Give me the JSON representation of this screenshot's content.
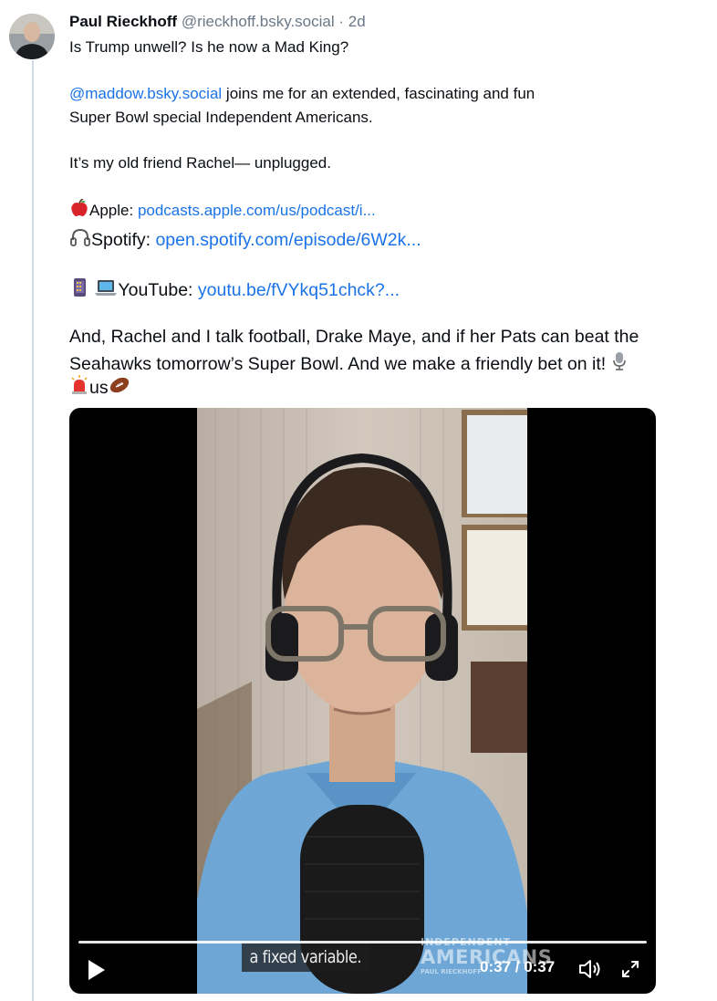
{
  "post": {
    "author_name": "Paul Rieckhoff",
    "author_handle": "@rieckhoff.bsky.social",
    "separator": " · ",
    "time": "2d",
    "line1": "Is Trump unwell? Is he now a Mad King?",
    "mention": "@maddow.bsky.social",
    "line2_rest": "  joins me for an extended, fascinating and fun",
    "line3": "Super Bowl special Independent Americans.",
    "line4": "It’s my old friend Rachel— unplugged.",
    "apple_label": "Apple: ",
    "apple_link": "podcasts.apple.com/us/podcast/i...",
    "spotify_label": "Spotify: ",
    "spotify_link": "open.spotify.com/episode/6W2k...",
    "youtube_label": "YouTube: ",
    "youtube_link": "youtu.be/fVYkq51chck?...",
    "para1": "And, Rachel and I talk football, Drake Maye, and if her Pats can beat the",
    "para2": "Seahawks tomorrow’s Super Bowl. And we make a friendly bet on it!",
    "para3": "us"
  },
  "icons": {
    "apple": "apple-emoji",
    "headphones": "headphones-emoji",
    "phone": "mobile-phone-emoji",
    "laptop": "laptop-emoji",
    "microphone": "microphone-emoji",
    "siren": "siren-emoji",
    "football": "football-emoji"
  },
  "video": {
    "caption": "a fixed variable.",
    "watermark_top": "INDEPENDENT",
    "watermark_main": "AMERICANS",
    "watermark_sub": "PAUL RIECKHOFF",
    "time_display": "0:37 / 0:37",
    "progress": 1.0
  },
  "colors": {
    "link": "#1a73e8",
    "handle": "#6b7886",
    "thread_line": "#d4dbe2"
  }
}
